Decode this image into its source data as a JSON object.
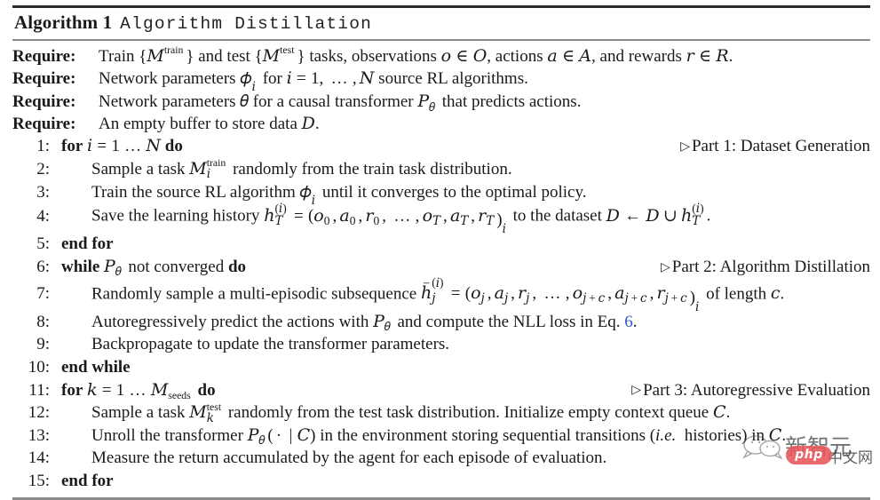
{
  "title": {
    "label": "Algorithm 1",
    "name": "Algorithm Distillation"
  },
  "requires": [
    {
      "keyword": "Require:",
      "text": "Train {Mtrain} and test {Mtest} tasks, observations o ∈ O, actions a ∈ A, and rewards r ∈ R."
    },
    {
      "keyword": "Require:",
      "text": "Network parameters φi for i = 1,…,N source RL algorithms."
    },
    {
      "keyword": "Require:",
      "text": "Network parameters θ for a causal transformer Pθ that predicts actions."
    },
    {
      "keyword": "Require:",
      "text": "An empty buffer to store data D."
    }
  ],
  "lines": [
    {
      "num": "1:",
      "indent": 0,
      "text": "for i = 1 … N do",
      "comment": "Part 1: Dataset Generation"
    },
    {
      "num": "2:",
      "indent": 1,
      "text": "Sample a task Mitrain randomly from the train task distribution.",
      "comment": ""
    },
    {
      "num": "3:",
      "indent": 1,
      "text": "Train the source RL algorithm φi until it converges to the optimal policy.",
      "comment": ""
    },
    {
      "num": "4:",
      "indent": 1,
      "text": "Save the learning history hT(i) = (o0, a0, r0, …, oT, aT, rT)i to the dataset D ← D ∪ hT(i).",
      "comment": ""
    },
    {
      "num": "5:",
      "indent": 0,
      "text": "end for",
      "comment": ""
    },
    {
      "num": "6:",
      "indent": 0,
      "text": "while Pθ not converged do",
      "comment": "Part 2: Algorithm Distillation"
    },
    {
      "num": "7:",
      "indent": 1,
      "text": "Randomly sample a multi-episodic subsequence h̄j(i) = (oj, aj, rj, …, oj+c, aj+c, rj+c)i of length c.",
      "comment": ""
    },
    {
      "num": "8:",
      "indent": 1,
      "text": "Autoregressively predict the actions with Pθ and compute the NLL loss in Eq. 6.",
      "comment": ""
    },
    {
      "num": "9:",
      "indent": 1,
      "text": "Backpropagate to update the transformer parameters.",
      "comment": ""
    },
    {
      "num": "10:",
      "indent": 0,
      "text": "end while",
      "comment": ""
    },
    {
      "num": "11:",
      "indent": 0,
      "text": "for k = 1 … Mseeds do",
      "comment": "Part 3: Autoregressive Evaluation"
    },
    {
      "num": "12:",
      "indent": 1,
      "text": "Sample a task Mktest randomly from the test task distribution. Initialize empty context queue C.",
      "comment": ""
    },
    {
      "num": "13:",
      "indent": 1,
      "text": "Unroll the transformer Pθ(·|C) in the environment storing sequential transitions (i.e. histories) in C.",
      "comment": ""
    },
    {
      "num": "14:",
      "indent": 1,
      "text": "Measure the return accumulated by the agent for each episode of evaluation.",
      "comment": ""
    },
    {
      "num": "15:",
      "indent": 0,
      "text": "end for",
      "comment": ""
    }
  ],
  "comments": {
    "part1": "Part 1: Dataset Generation",
    "part2": "Part 2: Algorithm Distillation",
    "part3": "Part 3: Autoregressive Evaluation",
    "marker": "▷"
  },
  "link": {
    "equation_ref": "6",
    "color": "#3355cc"
  },
  "keywords": {
    "require": "Require:",
    "for": "for",
    "do": "do",
    "end_for": "end for",
    "while": "while",
    "end_while": "end while"
  },
  "watermark": {
    "text_cn": "新智元",
    "text_cn2": "中文网",
    "badge": "php",
    "badge_color": "#e8565a"
  }
}
